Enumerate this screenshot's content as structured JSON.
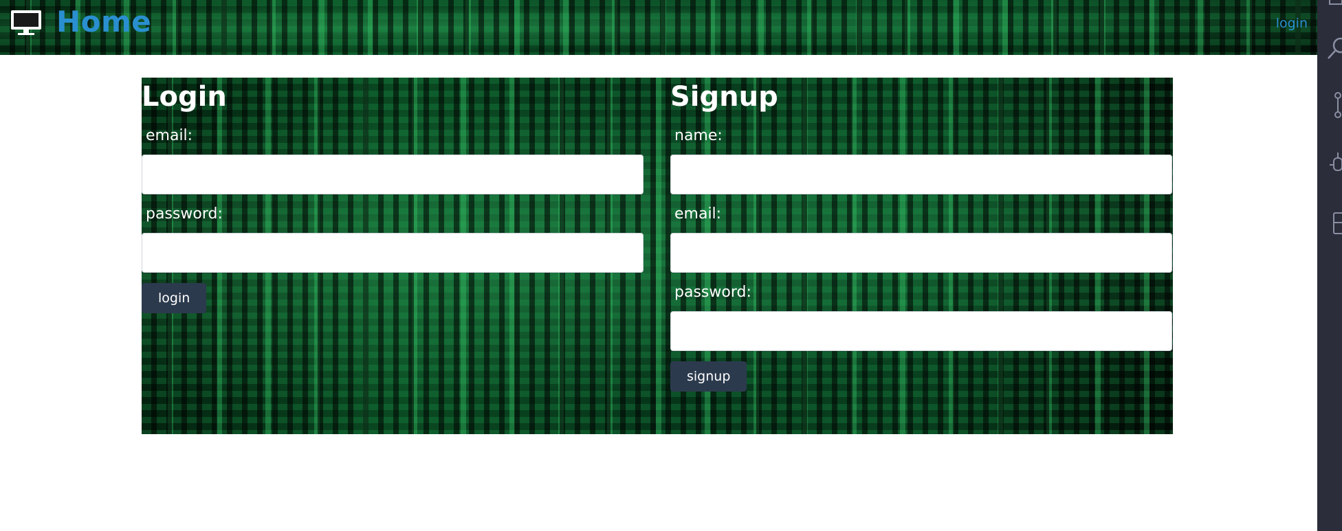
{
  "header": {
    "title": "Home",
    "login_link": "login",
    "icon": "monitor-icon"
  },
  "login": {
    "heading": "Login",
    "email_label": "email:",
    "email_value": "",
    "password_label": "password:",
    "password_value": "",
    "button_label": "login"
  },
  "signup": {
    "heading": "Signup",
    "name_label": "name:",
    "name_value": "",
    "email_label": "email:",
    "email_value": "",
    "password_label": "password:",
    "password_value": "",
    "button_label": "signup"
  },
  "activity_bar": {
    "icons": [
      "explorer-icon",
      "search-icon",
      "source-control-icon",
      "debug-icon",
      "extensions-icon"
    ]
  },
  "colors": {
    "accent": "#2a8fd0",
    "button": "#2c3a4d",
    "sidebar": "#2b2d3a"
  }
}
